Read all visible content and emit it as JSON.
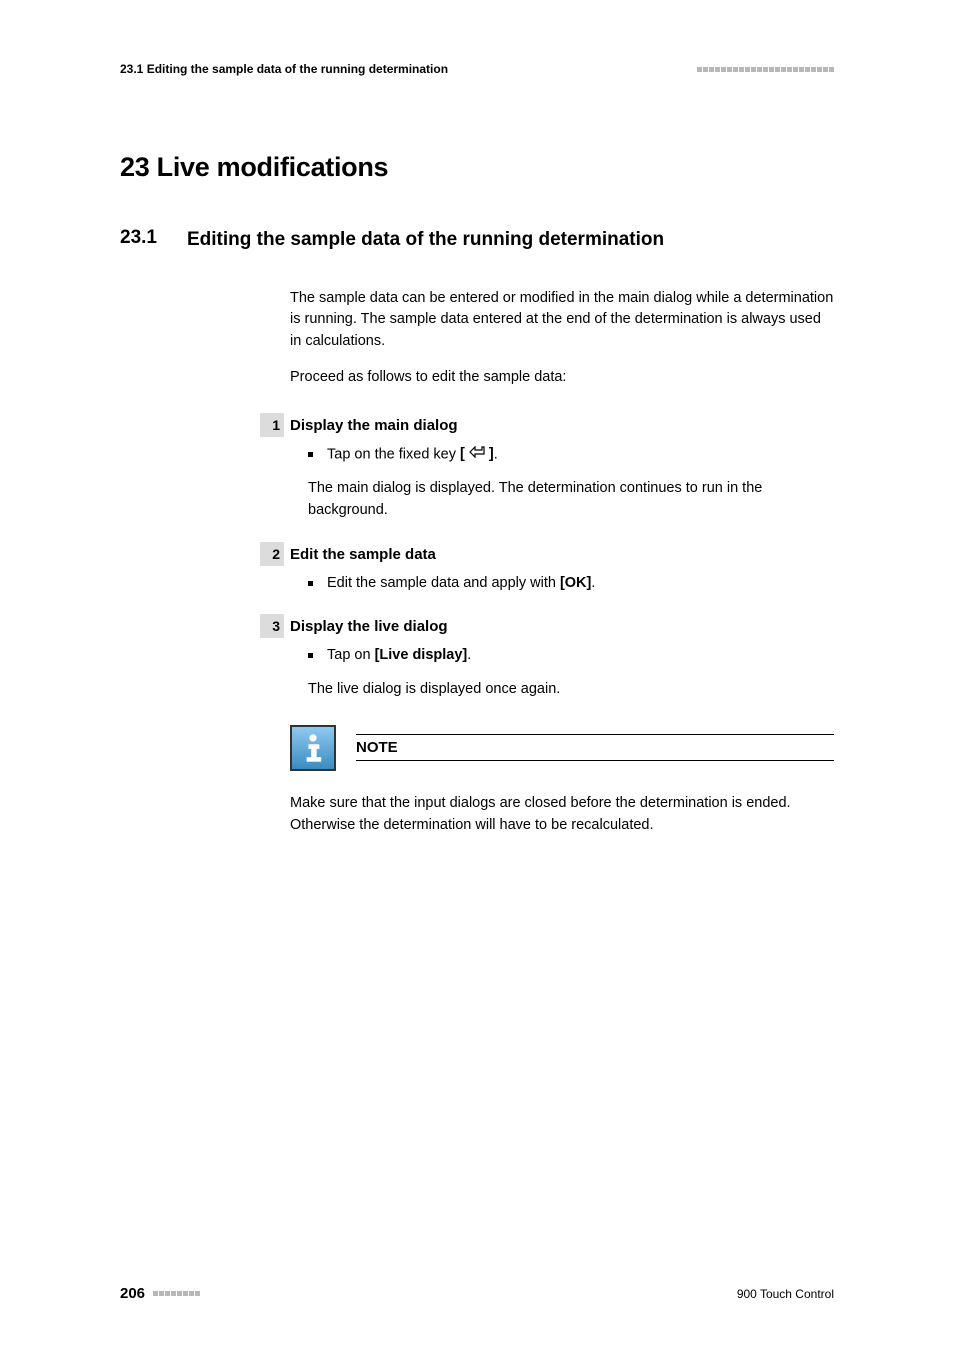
{
  "header": {
    "left": "23.1 Editing the sample data of the running determination"
  },
  "chapter": {
    "title": "23 Live modifications"
  },
  "section": {
    "number": "23.1",
    "title": "Editing the sample data of the running determination"
  },
  "intro": {
    "p1": "The sample data can be entered or modified in the main dialog while a determination is running. The sample data entered at the end of the determination is always used in calculations.",
    "p2": "Proceed as follows to edit the sample data:"
  },
  "steps": [
    {
      "num": "1",
      "title": "Display the main dialog",
      "bullet_prefix": "Tap on the fixed key ",
      "bullet_bold_open": "[ ",
      "bullet_bold_close": " ]",
      "bullet_suffix": ".",
      "body": "The main dialog is displayed. The determination continues to run in the background."
    },
    {
      "num": "2",
      "title": "Edit the sample data",
      "bullet_prefix": "Edit the sample data and apply with ",
      "bullet_bold": "[OK]",
      "bullet_suffix": "."
    },
    {
      "num": "3",
      "title": "Display the live dialog",
      "bullet_prefix": "Tap on ",
      "bullet_bold": "[Live display]",
      "bullet_suffix": ".",
      "body": "The live dialog is displayed once again."
    }
  ],
  "note": {
    "label": "NOTE",
    "text": "Make sure that the input dialogs are closed before the determination is ended. Otherwise the determination will have to be recalculated."
  },
  "footer": {
    "page": "206",
    "doc": "900 Touch Control"
  }
}
